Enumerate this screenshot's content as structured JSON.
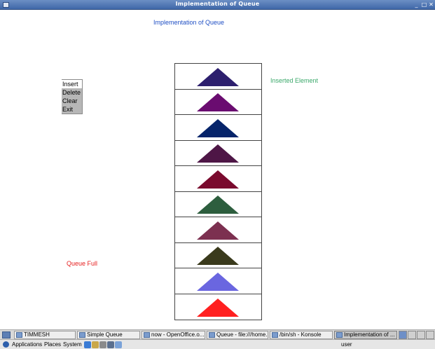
{
  "window": {
    "title": "Implementation of Queue"
  },
  "app": {
    "heading": "Implementation of Queue"
  },
  "menu": {
    "items": [
      "Insert",
      "Delete",
      "Clear",
      "Exit"
    ]
  },
  "status": {
    "inserted": "Inserted Element",
    "full": "Queue Full"
  },
  "queue": {
    "colors": [
      "#2d1f6e",
      "#6a0c70",
      "#06246a",
      "#4e1646",
      "#7a0a2e",
      "#2d5e3e",
      "#7c3050",
      "#3a3a1c",
      "#6a66e0",
      "#ff2020"
    ]
  },
  "taskbar": {
    "tasks": [
      "TIMMESH",
      "Simple Queue",
      "now - OpenOffice.o...",
      "Queue - file:///home...",
      "/bin/sh - Konsole",
      "Implementation of ..."
    ]
  },
  "panel": {
    "applications": "Applications",
    "places": "Places",
    "system": "System",
    "user": "user"
  }
}
